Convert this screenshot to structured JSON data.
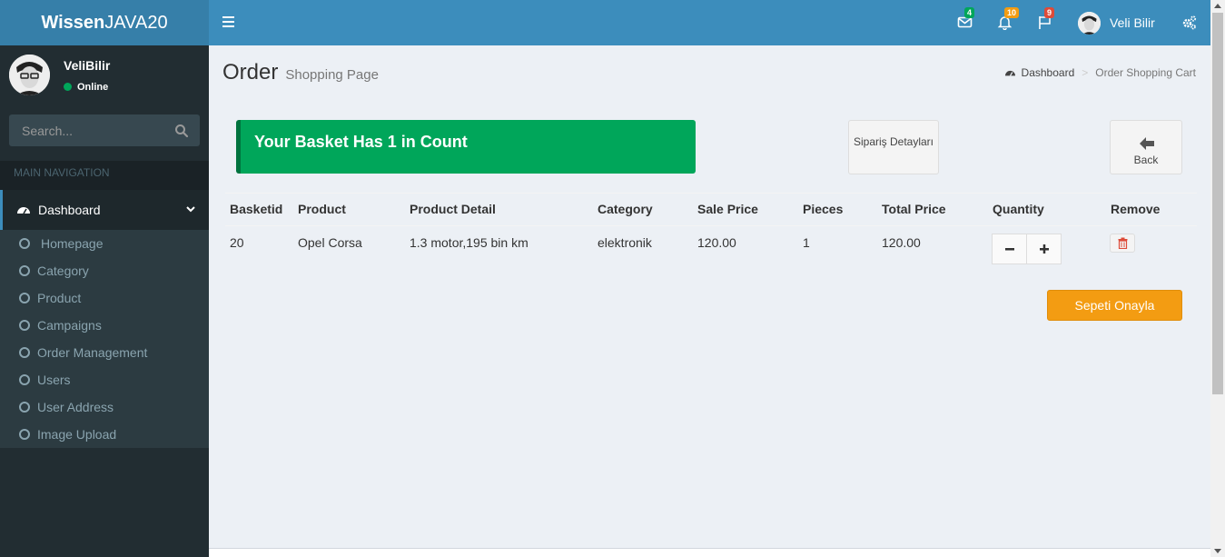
{
  "brand": {
    "bold": "Wissen",
    "rest": "JAVA20"
  },
  "sidebar": {
    "user_name": "VeliBilir",
    "user_status": "Online",
    "search_placeholder": "Search...",
    "nav_header": "MAIN NAVIGATION",
    "active_item": "Dashboard",
    "items": [
      {
        "label": "Homepage"
      },
      {
        "label": "Category"
      },
      {
        "label": "Product"
      },
      {
        "label": "Campaigns"
      },
      {
        "label": "Order Management"
      },
      {
        "label": "Users"
      },
      {
        "label": "User Address"
      },
      {
        "label": "Image Upload"
      }
    ]
  },
  "navbar": {
    "messages_count": "4",
    "notifications_count": "10",
    "tasks_count": "9",
    "user_name": "Veli Bilir",
    "colors": {
      "messages": "#00a65a",
      "notifications": "#f39c12",
      "tasks": "#dd4b39"
    }
  },
  "content": {
    "title": "Order",
    "subtitle": "Shopping Page",
    "breadcrumb": {
      "home": "Dashboard",
      "current": "Order Shopping Cart"
    },
    "callout": "Your Basket Has 1 in Count",
    "detail_button": "Sipariş Detayları",
    "back_button": "Back",
    "confirm_button": "Sepeti Onayla"
  },
  "table": {
    "headers": [
      "Basketid",
      "Product",
      "Product Detail",
      "Category",
      "Sale Price",
      "Pieces",
      "Total Price",
      "Quantity",
      "Remove"
    ],
    "rows": [
      {
        "basketid": "20",
        "product": "Opel Corsa",
        "detail": "1.3 motor,195 bin km",
        "category": "elektronik",
        "sale_price": "120.00",
        "pieces": "1",
        "total_price": "120.00"
      }
    ]
  }
}
